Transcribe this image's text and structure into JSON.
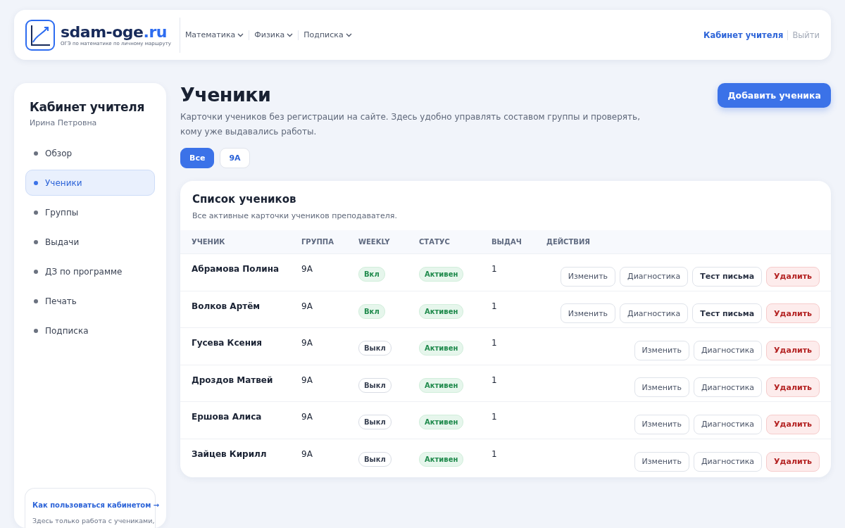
{
  "header": {
    "logo": {
      "name": "sdam-oge",
      "tld": ".ru",
      "tagline": "ОГЭ по математике по личному маршруту"
    },
    "nav": [
      {
        "label": "Математика"
      },
      {
        "label": "Физика"
      },
      {
        "label": "Подписка"
      }
    ],
    "account": {
      "link": "Кабинет учителя",
      "logout": "Выйти"
    }
  },
  "sidebar": {
    "title": "Кабинет учителя",
    "subtitle": "Ирина Петровна",
    "items": [
      {
        "label": "Обзор",
        "selected": false
      },
      {
        "label": "Ученики",
        "selected": true
      },
      {
        "label": "Группы",
        "selected": false
      },
      {
        "label": "Выдачи",
        "selected": false
      },
      {
        "label": "ДЗ по программе",
        "selected": false
      },
      {
        "label": "Печать",
        "selected": false
      },
      {
        "label": "Подписка",
        "selected": false
      }
    ],
    "help": {
      "link": "Как пользоваться кабинетом →",
      "text": "Здесь только работа с учениками,"
    }
  },
  "page": {
    "title": "Ученики",
    "description": "Карточки учеников без регистрации на сайте. Здесь удобно управлять составом группы и проверять, кому уже выдавались работы.",
    "add_button": "Добавить ученика",
    "filters": [
      {
        "label": "Все",
        "selected": true
      },
      {
        "label": "9А",
        "selected": false
      }
    ]
  },
  "table": {
    "title": "Список учеников",
    "subtitle": "Все активные карточки учеников преподавателя.",
    "columns": [
      "УЧЕНИК",
      "ГРУППА",
      "WEEKLY",
      "СТАТУС",
      "ВЫДАЧ",
      "ДЕЙСТВИЯ"
    ],
    "rows": [
      {
        "name": "Абрамова Полина",
        "group": "9А",
        "weekly": "Вкл",
        "weekly_on": true,
        "status": "Активен",
        "issued": "1",
        "actions": [
          {
            "label": "Изменить",
            "kind": "default"
          },
          {
            "label": "Диагностика",
            "kind": "default"
          },
          {
            "label": "Тест письма",
            "kind": "strong"
          },
          {
            "label": "Удалить",
            "kind": "danger"
          }
        ]
      },
      {
        "name": "Волков Артём",
        "group": "9А",
        "weekly": "Вкл",
        "weekly_on": true,
        "status": "Активен",
        "issued": "1",
        "actions": [
          {
            "label": "Изменить",
            "kind": "default"
          },
          {
            "label": "Диагностика",
            "kind": "default"
          },
          {
            "label": "Тест письма",
            "kind": "strong"
          },
          {
            "label": "Удалить",
            "kind": "danger"
          }
        ]
      },
      {
        "name": "Гусева Ксения",
        "group": "9А",
        "weekly": "Выкл",
        "weekly_on": false,
        "status": "Активен",
        "issued": "1",
        "actions": [
          {
            "label": "Изменить",
            "kind": "default"
          },
          {
            "label": "Диагностика",
            "kind": "default"
          },
          {
            "label": "Удалить",
            "kind": "danger"
          }
        ]
      },
      {
        "name": "Дроздов Матвей",
        "group": "9А",
        "weekly": "Выкл",
        "weekly_on": false,
        "status": "Активен",
        "issued": "1",
        "actions": [
          {
            "label": "Изменить",
            "kind": "default"
          },
          {
            "label": "Диагностика",
            "kind": "default"
          },
          {
            "label": "Удалить",
            "kind": "danger"
          }
        ]
      },
      {
        "name": "Ершова Алиса",
        "group": "9А",
        "weekly": "Выкл",
        "weekly_on": false,
        "status": "Активен",
        "issued": "1",
        "actions": [
          {
            "label": "Изменить",
            "kind": "default"
          },
          {
            "label": "Диагностика",
            "kind": "default"
          },
          {
            "label": "Удалить",
            "kind": "danger"
          }
        ]
      },
      {
        "name": "Зайцев Кирилл",
        "group": "9А",
        "weekly": "Выкл",
        "weekly_on": false,
        "status": "Активен",
        "issued": "1",
        "actions": [
          {
            "label": "Изменить",
            "kind": "default"
          },
          {
            "label": "Диагностика",
            "kind": "default"
          },
          {
            "label": "Удалить",
            "kind": "danger"
          }
        ]
      }
    ]
  }
}
